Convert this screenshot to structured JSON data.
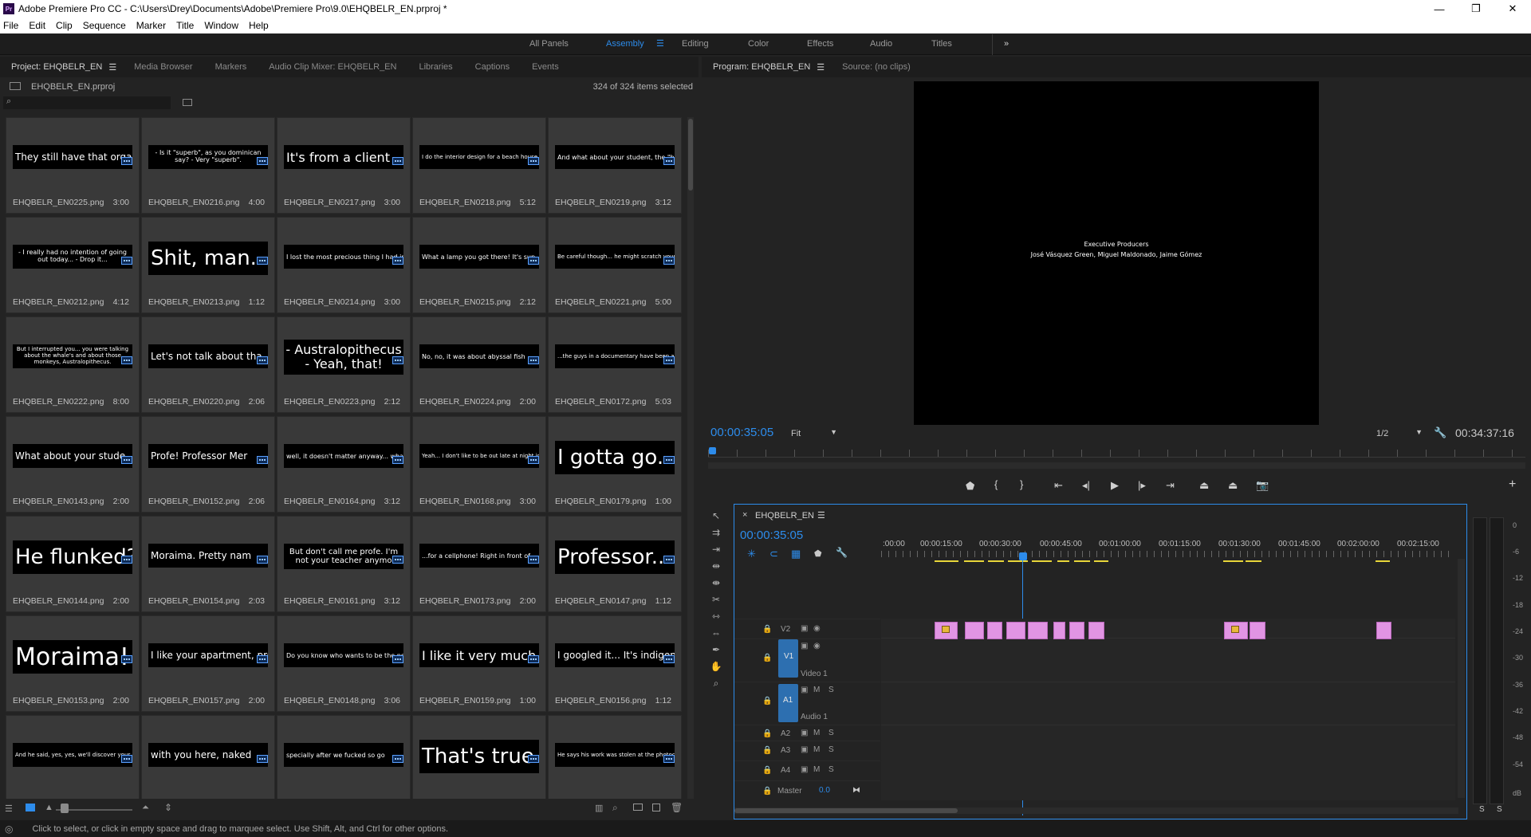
{
  "window": {
    "title": "Adobe Premiere Pro CC - C:\\Users\\Drey\\Documents\\Adobe\\Premiere Pro\\9.0\\EHQBELR_EN.prproj *",
    "logo": "Pr",
    "minimize": "—",
    "maximize": "❐",
    "close": "✕"
  },
  "menu": [
    "File",
    "Edit",
    "Clip",
    "Sequence",
    "Marker",
    "Title",
    "Window",
    "Help"
  ],
  "workspaces": {
    "items": [
      "All Panels",
      "Assembly",
      "Editing",
      "Color",
      "Effects",
      "Audio",
      "Titles"
    ],
    "active": "Assembly",
    "more": "»"
  },
  "project_panel": {
    "tabs": [
      "Project: EHQBELR_EN",
      "Media Browser",
      "Markers",
      "Audio Clip Mixer: EHQBELR_EN",
      "Libraries",
      "Captions",
      "Events"
    ],
    "file": "EHQBELR_EN.prproj",
    "selection": "324 of 324 items selected",
    "search_placeholder": "",
    "items": [
      {
        "thumb": "They still have that orga",
        "size": "s",
        "name": "EHQBELR_EN0225.png",
        "dur": "3:00"
      },
      {
        "thumb": "- Is it \"superb\", as you dominican say? - Very \"superb\".",
        "size": "xs",
        "name": "EHQBELR_EN0216.png",
        "dur": "4:00"
      },
      {
        "thumb": "It's from a client",
        "size": "m",
        "name": "EHQBELR_EN0217.png",
        "dur": "3:00"
      },
      {
        "thumb": "I do the interior design for a beach house he has in Juan",
        "size": "xxs",
        "name": "EHQBELR_EN0218.png",
        "dur": "5:12"
      },
      {
        "thumb": "And what about your student, the \"bro",
        "size": "xs",
        "name": "EHQBELR_EN0219.png",
        "dur": "3:12"
      },
      {
        "thumb": "- I really had no intention of going out today... - Drop it...",
        "size": "xs",
        "name": "EHQBELR_EN0212.png",
        "dur": "4:12"
      },
      {
        "thumb": "Shit, man.",
        "size": "l",
        "name": "EHQBELR_EN0213.png",
        "dur": "1:12"
      },
      {
        "thumb": "I lost the most precious thing I had in d",
        "size": "xs",
        "name": "EHQBELR_EN0214.png",
        "dur": "3:00"
      },
      {
        "thumb": "What a lamp you got there! It's sup",
        "size": "xs",
        "name": "EHQBELR_EN0215.png",
        "dur": "2:12"
      },
      {
        "thumb": "Be careful though... he might scratch your car or flatten you",
        "size": "xxs",
        "name": "EHQBELR_EN0221.png",
        "dur": "5:00"
      },
      {
        "thumb": "But I interrupted you... you were talking about the whale's and about those monkeys, Australopithecus.",
        "size": "xxs",
        "name": "EHQBELR_EN0222.png",
        "dur": "8:00"
      },
      {
        "thumb": "Let's not talk about tha",
        "size": "s",
        "name": "EHQBELR_EN0220.png",
        "dur": "2:06"
      },
      {
        "thumb": "- Australopithecus - Yeah, that!",
        "size": "m2",
        "name": "EHQBELR_EN0223.png",
        "dur": "2:12"
      },
      {
        "thumb": "No, no, it was about abyssal fish",
        "size": "xs",
        "name": "EHQBELR_EN0224.png",
        "dur": "2:00"
      },
      {
        "thumb": "...the guys in a documentary have been a proposal mutation or dog",
        "size": "xxs",
        "name": "EHQBELR_EN0172.png",
        "dur": "5:03"
      },
      {
        "thumb": "What about your stude",
        "size": "s",
        "name": "EHQBELR_EN0143.png",
        "dur": "2:00"
      },
      {
        "thumb": "Profe! Professor Mer",
        "size": "s",
        "name": "EHQBELR_EN0152.png",
        "dur": "2:06"
      },
      {
        "thumb": "well, it doesn't matter anyway... whate",
        "size": "xs",
        "name": "EHQBELR_EN0164.png",
        "dur": "3:12"
      },
      {
        "thumb": "Yeah... I don't like to be out late at night in that neighbor",
        "size": "xxs",
        "name": "EHQBELR_EN0168.png",
        "dur": "3:00"
      },
      {
        "thumb": "I gotta go.",
        "size": "l",
        "name": "EHQBELR_EN0179.png",
        "dur": "1:00"
      },
      {
        "thumb": "He flunked?",
        "size": "l",
        "name": "EHQBELR_EN0144.png",
        "dur": "2:00"
      },
      {
        "thumb": "Moraima. Pretty nam",
        "size": "s",
        "name": "EHQBELR_EN0154.png",
        "dur": "2:03"
      },
      {
        "thumb": "But don't call me profe. I'm not your teacher anymo",
        "size": "s2",
        "name": "EHQBELR_EN0161.png",
        "dur": "3:12"
      },
      {
        "thumb": "...for a cellphone! Right in front of",
        "size": "xs",
        "name": "EHQBELR_EN0173.png",
        "dur": "2:00"
      },
      {
        "thumb": "Professor...",
        "size": "l",
        "name": "EHQBELR_EN0147.png",
        "dur": "1:12"
      },
      {
        "thumb": "Moraima!",
        "size": "xl",
        "name": "EHQBELR_EN0153.png",
        "dur": "2:00"
      },
      {
        "thumb": "I like your apartment, pro",
        "size": "s",
        "name": "EHQBELR_EN0157.png",
        "dur": "2:00"
      },
      {
        "thumb": "Do you know who wants to be the new Re",
        "size": "xs",
        "name": "EHQBELR_EN0148.png",
        "dur": "3:06"
      },
      {
        "thumb": "I like it very much",
        "size": "m",
        "name": "EHQBELR_EN0159.png",
        "dur": "1:00"
      },
      {
        "thumb": "I googled it... It's indigenou",
        "size": "s",
        "name": "EHQBELR_EN0156.png",
        "dur": "1:12"
      },
      {
        "thumb": "And he said, yes, yes, we'll discover your secondary for shell",
        "size": "xxs",
        "name": "",
        "dur": ""
      },
      {
        "thumb": "with you here, naked",
        "size": "s",
        "name": "",
        "dur": ""
      },
      {
        "thumb": "specially after we fucked so go",
        "size": "xs",
        "name": "",
        "dur": ""
      },
      {
        "thumb": "That's true.",
        "size": "l",
        "name": "",
        "dur": ""
      },
      {
        "thumb": "He says his work was stolen at the photocopier",
        "size": "xxs",
        "name": "",
        "dur": ""
      }
    ]
  },
  "program_monitor": {
    "tabs": [
      "Program: EHQBELR_EN",
      "Source: (no clips)"
    ],
    "frame_line1": "Executive Producers",
    "frame_line2": "José Vásquez Green, Miguel Maldonado, Jaime Gómez",
    "timecode": "00:00:35:05",
    "fit": "Fit",
    "resolution": "1/2",
    "duration": "00:34:37:16",
    "add": "+"
  },
  "timeline": {
    "tab": "EHQBELR_EN",
    "close": "×",
    "timecode": "00:00:35:05",
    "ruler": [
      ":00:00",
      "00:00:15:00",
      "00:00:30:00",
      "00:00:45:00",
      "00:01:00:00",
      "00:01:15:00",
      "00:01:30:00",
      "00:01:45:00",
      "00:02:00:00",
      "00:02:15:00"
    ],
    "tracks": {
      "v2": "V2",
      "v1": "V1",
      "video1": "Video 1",
      "a1": "A1",
      "audio1": "Audio 1",
      "a2": "A2",
      "a3": "A3",
      "a4": "A4",
      "master": "Master",
      "master_val": "0.0",
      "m": "M",
      "s": "S"
    },
    "meter_scale": [
      "0",
      "-6",
      "-12",
      "-18",
      "-24",
      "-30",
      "-36",
      "-42",
      "-48",
      "-54",
      "dB"
    ],
    "meter_solo": [
      "S",
      "S"
    ]
  },
  "status": {
    "text": "Click to select, or click in empty space and drag to marquee select. Use Shift, Alt, and Ctrl for other options."
  }
}
